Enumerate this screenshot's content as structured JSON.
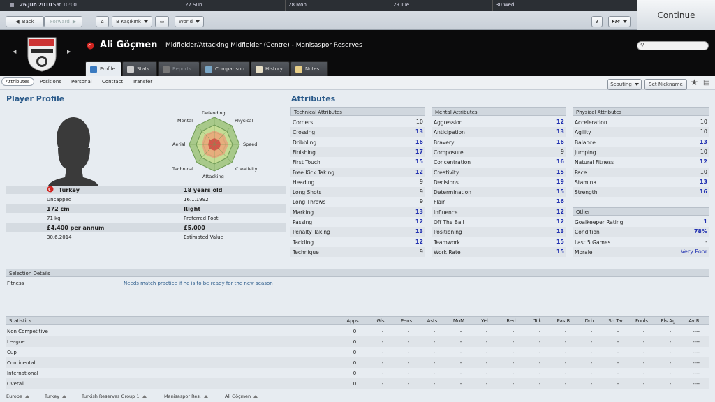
{
  "dates": {
    "d1": "26 Jun 2010",
    "d1b": "Sat 10:00",
    "d2": "27 Sun",
    "d3": "28 Mon",
    "d4": "29 Tue",
    "d5": "30 Wed"
  },
  "toolbar": {
    "back": "Back",
    "forward": "Forward",
    "club_select": "B Kaşıkınk",
    "world_select": "World",
    "help": "?",
    "fm_menu": "FM",
    "continue": "Continue"
  },
  "player": {
    "name": "Ali Göçmen",
    "description": "Midfielder/Attacking Midfielder (Centre) - Manisaspor Reserves"
  },
  "tabs": [
    "Profile",
    "Stats",
    "Reports",
    "Comparison",
    "History",
    "Notes"
  ],
  "subnav": [
    "Attributes",
    "Positions",
    "Personal",
    "Contract",
    "Transfer"
  ],
  "actions": {
    "scouting": "Scouting",
    "nickname": "Set Nickname"
  },
  "profile": {
    "title": "Player Profile",
    "radar_labels": {
      "mental": "Mental",
      "defending": "Defending",
      "physical": "Physical",
      "aerial": "Aerial",
      "speed": "Speed",
      "technical": "Technical",
      "attacking": "Attacking",
      "creativity": "Creativity"
    },
    "nationality": "Turkey",
    "caps": "Uncapped",
    "age": "18 years old",
    "dob": "16.1.1992",
    "height": "172 cm",
    "weight": "71 kg",
    "foot": "Right",
    "foot_label": "Preferred Foot",
    "wage": "£4,400 per annum",
    "contract_end": "30.6.2014",
    "value": "£5,000",
    "value_label": "Estimated Value"
  },
  "attributes": {
    "title": "Attributes",
    "technical": {
      "header": "Technical Attributes",
      "rows": [
        [
          "Corners",
          "10"
        ],
        [
          "Crossing",
          "13"
        ],
        [
          "Dribbling",
          "16"
        ],
        [
          "Finishing",
          "17"
        ],
        [
          "First Touch",
          "15"
        ],
        [
          "Free Kick Taking",
          "12"
        ],
        [
          "Heading",
          "9"
        ],
        [
          "Long Shots",
          "9"
        ],
        [
          "Long Throws",
          "9"
        ],
        [
          "Marking",
          "13"
        ],
        [
          "Passing",
          "12"
        ],
        [
          "Penalty Taking",
          "13"
        ],
        [
          "Tackling",
          "12"
        ],
        [
          "Technique",
          "9"
        ]
      ]
    },
    "mental": {
      "header": "Mental Attributes",
      "rows": [
        [
          "Aggression",
          "12"
        ],
        [
          "Anticipation",
          "13"
        ],
        [
          "Bravery",
          "16"
        ],
        [
          "Composure",
          "9"
        ],
        [
          "Concentration",
          "16"
        ],
        [
          "Creativity",
          "15"
        ],
        [
          "Decisions",
          "19"
        ],
        [
          "Determination",
          "15"
        ],
        [
          "Flair",
          "16"
        ],
        [
          "Influence",
          "12"
        ],
        [
          "Off The Ball",
          "12"
        ],
        [
          "Positioning",
          "13"
        ],
        [
          "Teamwork",
          "15"
        ],
        [
          "Work Rate",
          "15"
        ]
      ]
    },
    "physical": {
      "header": "Physical Attributes",
      "rows": [
        [
          "Acceleration",
          "10"
        ],
        [
          "Agility",
          "10"
        ],
        [
          "Balance",
          "13"
        ],
        [
          "Jumping",
          "10"
        ],
        [
          "Natural Fitness",
          "12"
        ],
        [
          "Pace",
          "10"
        ],
        [
          "Stamina",
          "13"
        ],
        [
          "Strength",
          "16"
        ]
      ]
    },
    "other": {
      "header": "Other",
      "rows": [
        [
          "Goalkeeper Rating",
          "1"
        ],
        [
          "Condition",
          "78%"
        ],
        [
          "Last 5 Games",
          "-"
        ],
        [
          "Morale",
          "Very Poor"
        ]
      ]
    }
  },
  "selection": {
    "header": "Selection Details",
    "label": "Fitness",
    "value": "Needs match practice if he is to be ready for the new season"
  },
  "statistics": {
    "header": "Statistics",
    "columns": [
      "Apps",
      "Gls",
      "Pens",
      "Asts",
      "MoM",
      "Yel",
      "Red",
      "Tck",
      "Pas R",
      "Drb",
      "Sh Tar",
      "Fouls",
      "Fls Ag",
      "Av R"
    ],
    "rows": [
      [
        "Non Competitive",
        "0",
        "-",
        "-",
        "-",
        "-",
        "-",
        "-",
        "-",
        "-",
        "-",
        "-",
        "-",
        "-",
        "----"
      ],
      [
        "League",
        "0",
        "-",
        "-",
        "-",
        "-",
        "-",
        "-",
        "-",
        "-",
        "-",
        "-",
        "-",
        "-",
        "----"
      ],
      [
        "Cup",
        "0",
        "-",
        "-",
        "-",
        "-",
        "-",
        "-",
        "-",
        "-",
        "-",
        "-",
        "-",
        "-",
        "----"
      ],
      [
        "Continental",
        "0",
        "-",
        "-",
        "-",
        "-",
        "-",
        "-",
        "-",
        "-",
        "-",
        "-",
        "-",
        "-",
        "----"
      ],
      [
        "International",
        "0",
        "-",
        "-",
        "-",
        "-",
        "-",
        "-",
        "-",
        "-",
        "-",
        "-",
        "-",
        "-",
        "----"
      ],
      [
        "Overall",
        "0",
        "-",
        "-",
        "-",
        "-",
        "-",
        "-",
        "-",
        "-",
        "-",
        "-",
        "-",
        "-",
        "----"
      ]
    ]
  },
  "breadcrumb": [
    "Europe",
    "Turkey",
    "Turkish Reserves Group 1",
    "Manisaspor Res.",
    "Ali Göçmen"
  ],
  "colors": {
    "highlight": "#1f2fb0",
    "title": "#2a5a8a",
    "header_bg": "#0b0b0c"
  }
}
